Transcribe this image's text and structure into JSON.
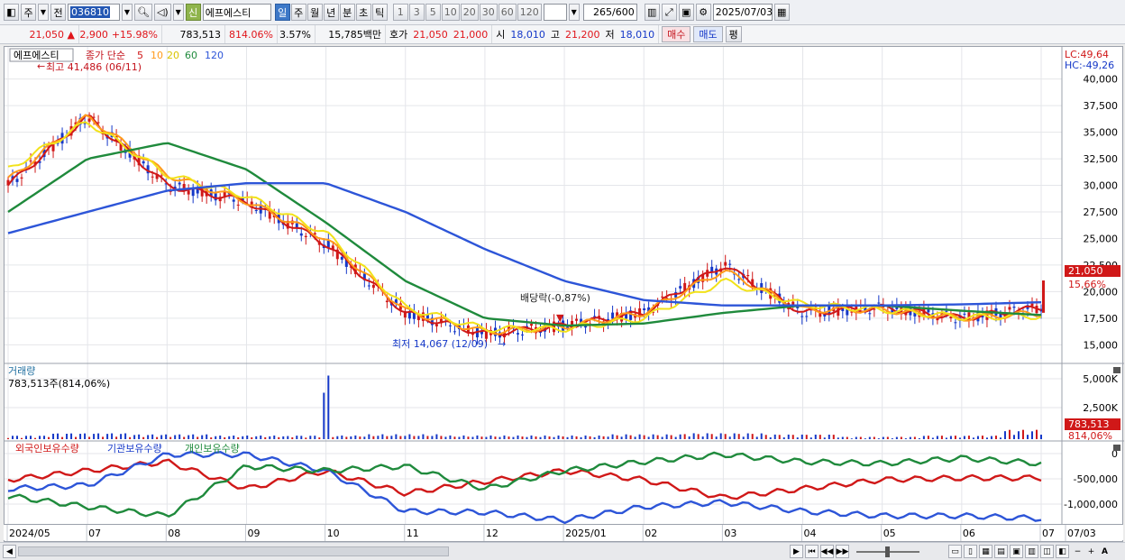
{
  "toolbar": {
    "market": "주",
    "prev": "전",
    "code": "036810",
    "sin": "신",
    "stock_name": "에프에스티",
    "periods": [
      "일",
      "주",
      "월",
      "년",
      "분",
      "초",
      "틱"
    ],
    "active_period": "일",
    "intervals": [
      "1",
      "3",
      "5",
      "10",
      "20",
      "30",
      "60",
      "120"
    ],
    "count": "265",
    "count_total": "/600",
    "date": "2025/07/03"
  },
  "quote": {
    "price": "21,050",
    "change": "2,900",
    "change_pct": "+15.98%",
    "volume": "783,513",
    "volume_ratio": "814.06%",
    "turnover": "3.57%",
    "amount": "15,785백만",
    "hoga_label": "호가",
    "ask": "21,050",
    "bid": "21,000",
    "open_label": "시",
    "open": "18,010",
    "high_label": "고",
    "high": "21,200",
    "low_label": "저",
    "low": "18,010",
    "buy": "매수",
    "sell": "매도",
    "eval": "평"
  },
  "price_panel": {
    "name_tag": "에프에스티",
    "ma_label": "종가 단순",
    "ma_periods": [
      "5",
      "10",
      "20",
      "60",
      "120"
    ],
    "ma_colors": [
      "#d01818",
      "#ff9a1a",
      "#f2e21a",
      "#1f8a3c",
      "#2d55d8"
    ],
    "lc": "LC:49,64",
    "hc": "HC:-49,26",
    "high_note": "최고 41,486 (06/11)",
    "low_note": "최저 14,067 (12/09)",
    "dividend_note": "배당락(-0,87%)",
    "y_ticks": [
      "40,000",
      "37,500",
      "35,000",
      "32,500",
      "30,000",
      "27,500",
      "25,000",
      "22,500",
      "20,000",
      "17,500",
      "15,000"
    ],
    "current_tag": "21,050",
    "current_pct": "15,66%"
  },
  "volume_panel": {
    "title": "거래량",
    "value": "783,513주(814,06%)",
    "y_ticks": [
      "5,000K",
      "2,500K",
      "0"
    ],
    "current_tag": "783,513",
    "current_pct": "814,06%"
  },
  "holdings_panel": {
    "foreign": "외국인보유수량",
    "institution": "기관보유수량",
    "individual": "개인보유수량",
    "y_ticks": [
      "0",
      "-500,000",
      "-1,000,000"
    ]
  },
  "x_ticks": [
    "2024/05",
    "07",
    "08",
    "09",
    "10",
    "11",
    "12",
    "2025/01",
    "02",
    "03",
    "04",
    "05",
    "06",
    "07",
    "07/03"
  ],
  "chart_data": {
    "type": "line",
    "title": "에프에스티",
    "x": [
      "2024/05",
      "07",
      "08",
      "09",
      "10",
      "11",
      "12",
      "2025/01",
      "02",
      "03",
      "04",
      "05",
      "06",
      "07"
    ],
    "series": [
      {
        "name": "종가 단순 5",
        "values": [
          30000,
          36500,
          30000,
          28500,
          24500,
          18000,
          16000,
          16800,
          18000,
          22500,
          18000,
          18500,
          17500,
          18500
        ]
      },
      {
        "name": "10",
        "values": [
          30500,
          36500,
          31000,
          28500,
          25000,
          18200,
          16200,
          16700,
          18000,
          22000,
          18300,
          18300,
          17500,
          18000
        ]
      },
      {
        "name": "20",
        "values": [
          31500,
          36000,
          31000,
          29000,
          25500,
          18500,
          16500,
          16500,
          17500,
          21000,
          18800,
          18300,
          17600,
          17700
        ]
      },
      {
        "name": "60",
        "values": [
          27500,
          32500,
          34000,
          31500,
          26500,
          21000,
          17500,
          16800,
          17000,
          18000,
          18700,
          18700,
          18200,
          17800
        ]
      },
      {
        "name": "120",
        "values": [
          25500,
          27500,
          29500,
          30200,
          30200,
          27500,
          24000,
          21000,
          19200,
          18700,
          18700,
          18700,
          18800,
          19000
        ]
      }
    ],
    "ylim": [
      13500,
      41500
    ],
    "volume": [
      300000,
      500000,
      400000,
      300000,
      5200000,
      400000,
      300000,
      300000,
      400000,
      500000,
      400000,
      200000,
      300000,
      783513
    ],
    "high": 41486,
    "low": 14067,
    "last": 21050
  }
}
